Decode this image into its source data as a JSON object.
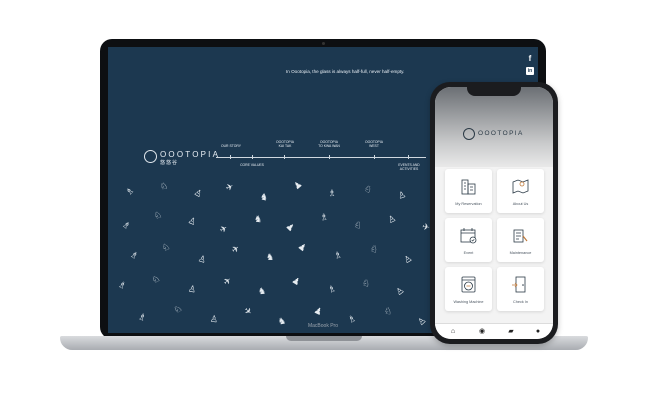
{
  "laptop": {
    "model_label": "MacBook Pro",
    "tagline": "In Oootopia, the glass is always half-full, never half-empty.",
    "brand": {
      "name": "OOOTOPIA",
      "sub": "悠悠谷"
    },
    "social": [
      {
        "icon": "facebook-icon",
        "glyph": "f"
      },
      {
        "icon": "linkedin-icon",
        "glyph": "in"
      }
    ],
    "timeline": [
      {
        "label": "OUR STORY",
        "pos": "top"
      },
      {
        "label": "CORE VALUES",
        "pos": "bottom"
      },
      {
        "label": "OOOTOPIA\nKAI TAK",
        "pos": "top"
      },
      {
        "label": "OOOTOPIA\nTO KWA WAN",
        "pos": "top"
      },
      {
        "label": "OOOTOPIA\nWEST",
        "pos": "top"
      },
      {
        "label": "EVENTS AND\nACTIVITIES",
        "pos": "bottom"
      }
    ]
  },
  "phone": {
    "brand": "OOOTOPIA",
    "menu": [
      {
        "label": "My Reservation",
        "icon": "building-icon"
      },
      {
        "label": "About Us",
        "icon": "map-icon"
      },
      {
        "label": "Event",
        "icon": "calendar-icon"
      },
      {
        "label": "Maintenance",
        "icon": "maintenance-icon"
      },
      {
        "label": "Washing Machine",
        "icon": "washing-machine-icon"
      },
      {
        "label": "Check In",
        "icon": "door-icon"
      }
    ],
    "tabs": [
      {
        "icon": "home-icon",
        "glyph": "⌂"
      },
      {
        "icon": "compass-icon",
        "glyph": "◉"
      },
      {
        "icon": "chat-icon",
        "glyph": "▰"
      },
      {
        "icon": "profile-icon",
        "glyph": "●"
      }
    ]
  },
  "colors": {
    "screen_bg": "#1c3850",
    "phone_bg": "#f3f3f3",
    "accent": "#2b3a46"
  }
}
